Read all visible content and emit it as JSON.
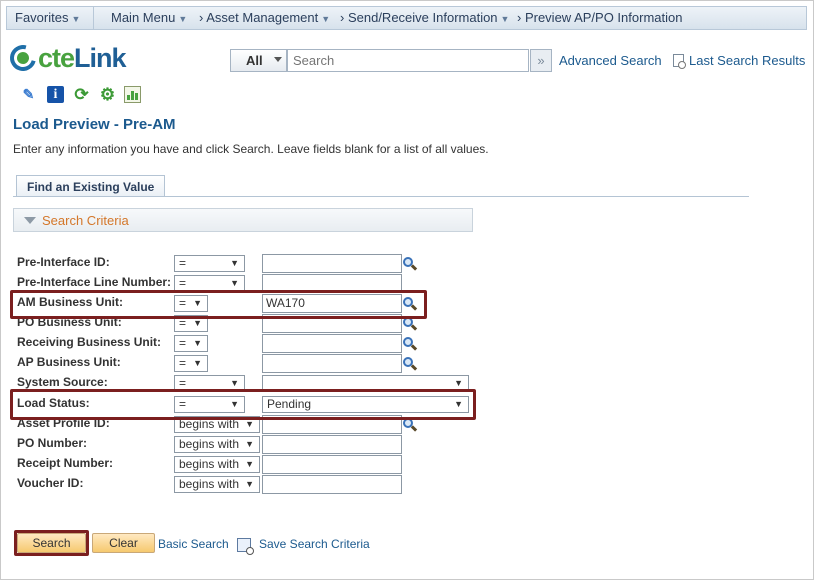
{
  "nav": {
    "favorites": "Favorites",
    "main_menu": "Main Menu",
    "breadcrumb": [
      "Asset Management",
      "Send/Receive Information",
      "Preview AP/PO Information"
    ]
  },
  "header": {
    "logo_cte": "cte",
    "logo_link": "Link",
    "search_scope": "All",
    "search_placeholder": "Search",
    "advanced_search": "Advanced Search",
    "last_search_results": "Last Search Results"
  },
  "toolbar_icons": [
    "edit-icon",
    "info-icon",
    "refresh-icon",
    "gear-icon",
    "chart-icon"
  ],
  "page": {
    "title": "Load Preview - Pre-AM",
    "instructions": "Enter any information you have and click Search. Leave fields blank for a list of all values.",
    "tab": "Find an Existing Value",
    "section": "Search Criteria"
  },
  "form": {
    "fields": [
      {
        "label": "Pre-Interface ID:",
        "operator": "=",
        "value": ""
      },
      {
        "label": "Pre-Interface Line Number:",
        "operator": "=",
        "value": ""
      },
      {
        "label": "AM Business Unit:",
        "operator": "=",
        "value": "WA170"
      },
      {
        "label": "PO Business Unit:",
        "operator": "=",
        "value": ""
      },
      {
        "label": "Receiving Business Unit:",
        "operator": "=",
        "value": ""
      },
      {
        "label": "AP Business Unit:",
        "operator": "=",
        "value": ""
      },
      {
        "label": "System Source:",
        "operator": "=",
        "value": ""
      },
      {
        "label": "Load Status:",
        "operator": "=",
        "value": "Pending"
      },
      {
        "label": "Asset Profile ID:",
        "operator": "begins with",
        "value": ""
      },
      {
        "label": "PO Number:",
        "operator": "begins with",
        "value": ""
      },
      {
        "label": "Receipt Number:",
        "operator": "begins with",
        "value": ""
      },
      {
        "label": "Voucher ID:",
        "operator": "begins with",
        "value": ""
      }
    ]
  },
  "buttons": {
    "search": "Search",
    "clear": "Clear",
    "basic_search": "Basic Search",
    "save_search_criteria": "Save Search Criteria"
  },
  "colors": {
    "accent": "#1c5a8e",
    "highlight": "#7b1f1f",
    "section_text": "#d4772a",
    "button": "#f6c96f"
  }
}
